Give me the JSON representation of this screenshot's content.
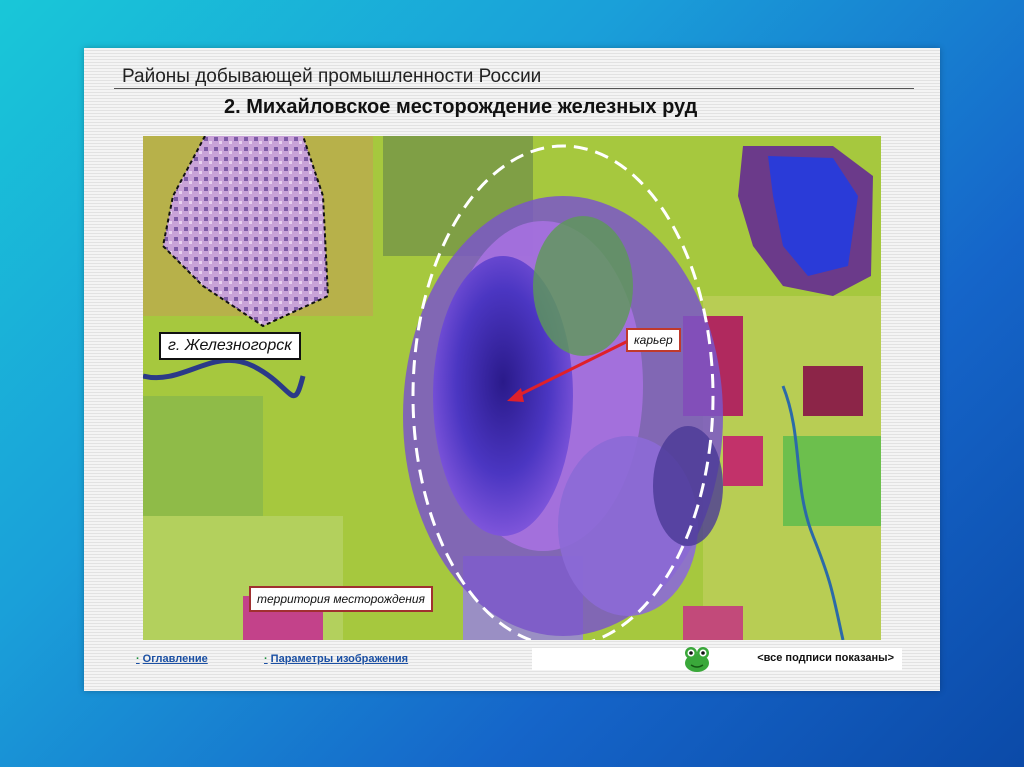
{
  "slide": {
    "header_title": "Районы добывающей промышленности России",
    "subtitle": "2. Михайловское месторождение железных руд"
  },
  "map": {
    "city_label": "г. Железногорск",
    "pit_label": "карьер",
    "field_label": "территория месторождения"
  },
  "footer": {
    "toc_link": "Оглавление",
    "params_link": "Параметры изображения",
    "captions_status": "<все подписи показаны>",
    "link_bullet": "·"
  },
  "colors": {
    "background_top": "#19c7d8",
    "background_bottom": "#0b4aa8",
    "link": "#1a4fa3"
  }
}
